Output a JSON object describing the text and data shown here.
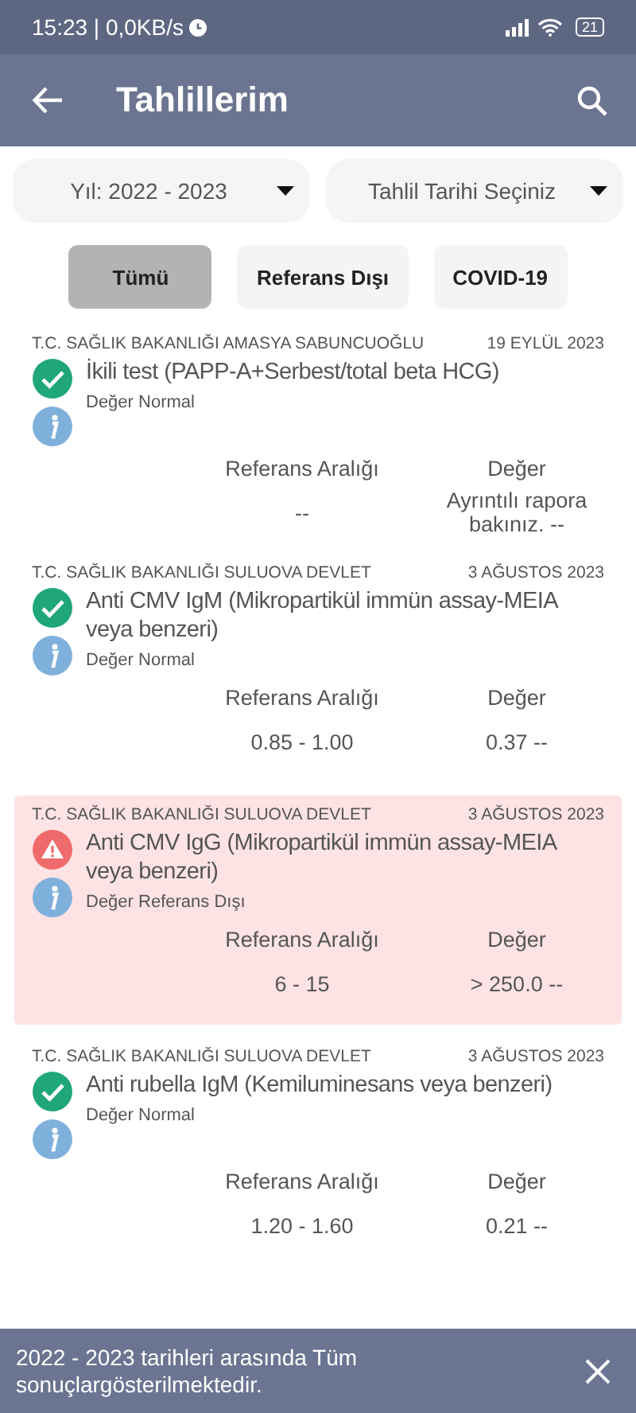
{
  "status_bar": {
    "time": "15:23 | 0,0KB/s",
    "battery": "21"
  },
  "app_bar": {
    "title": "Tahlillerim"
  },
  "filters": [
    {
      "value": "Yıl: 2022 - 2023"
    },
    {
      "value": "Tahlil Tarihi Seçiniz"
    }
  ],
  "chips": [
    {
      "label": "Tümü",
      "selected": true
    },
    {
      "label": "Referans Dışı",
      "selected": false
    },
    {
      "label": "COVID-19",
      "selected": false
    }
  ],
  "results": [
    {
      "hospital": "T.C. SAĞLIK BAKANLIĞI AMASYA SABUNCUOĞLU",
      "date": "19 EYLÜL 2023",
      "test": "İkili test (PAPP-A+Serbest/total beta HCG)",
      "out_of_range": false,
      "status_text": "Değer Normal",
      "range_label": "Referans Aralığı",
      "value_label": "Değer",
      "range": "--",
      "value": "Ayrıntılı rapora bakınız. --"
    },
    {
      "hospital": "T.C. SAĞLIK BAKANLIĞI SULUOVA DEVLET",
      "date": "3 AĞUSTOS 2023",
      "test": "Anti CMV IgM (Mikropartikül immün assay-MEIA veya benzeri)",
      "out_of_range": false,
      "status_text": "Değer Normal",
      "range_label": "Referans Aralığı",
      "value_label": "Değer",
      "range": "0.85 - 1.00",
      "value": "0.37 --"
    },
    {
      "hospital": "T.C. SAĞLIK BAKANLIĞI SULUOVA DEVLET",
      "date": "3 AĞUSTOS 2023",
      "test": "Anti CMV IgG (Mikropartikül immün assay-MEIA veya benzeri)",
      "out_of_range": true,
      "status_text": "Değer Referans Dışı",
      "range_label": "Referans Aralığı",
      "value_label": "Değer",
      "range": "6 - 15",
      "value": "> 250.0 --"
    },
    {
      "hospital": "T.C. SAĞLIK BAKANLIĞI SULUOVA DEVLET",
      "date": "3 AĞUSTOS 2023",
      "test": "Anti rubella IgM (Kemiluminesans veya benzeri)",
      "out_of_range": false,
      "status_text": "Değer Normal",
      "range_label": "Referans Aralığı",
      "value_label": "Değer",
      "range": "1.20 - 1.60",
      "value": "0.21 --"
    }
  ],
  "snackbar": {
    "message": "2022 - 2023 tarihleri arasında Tüm sonuçlargösterilmektedir."
  }
}
